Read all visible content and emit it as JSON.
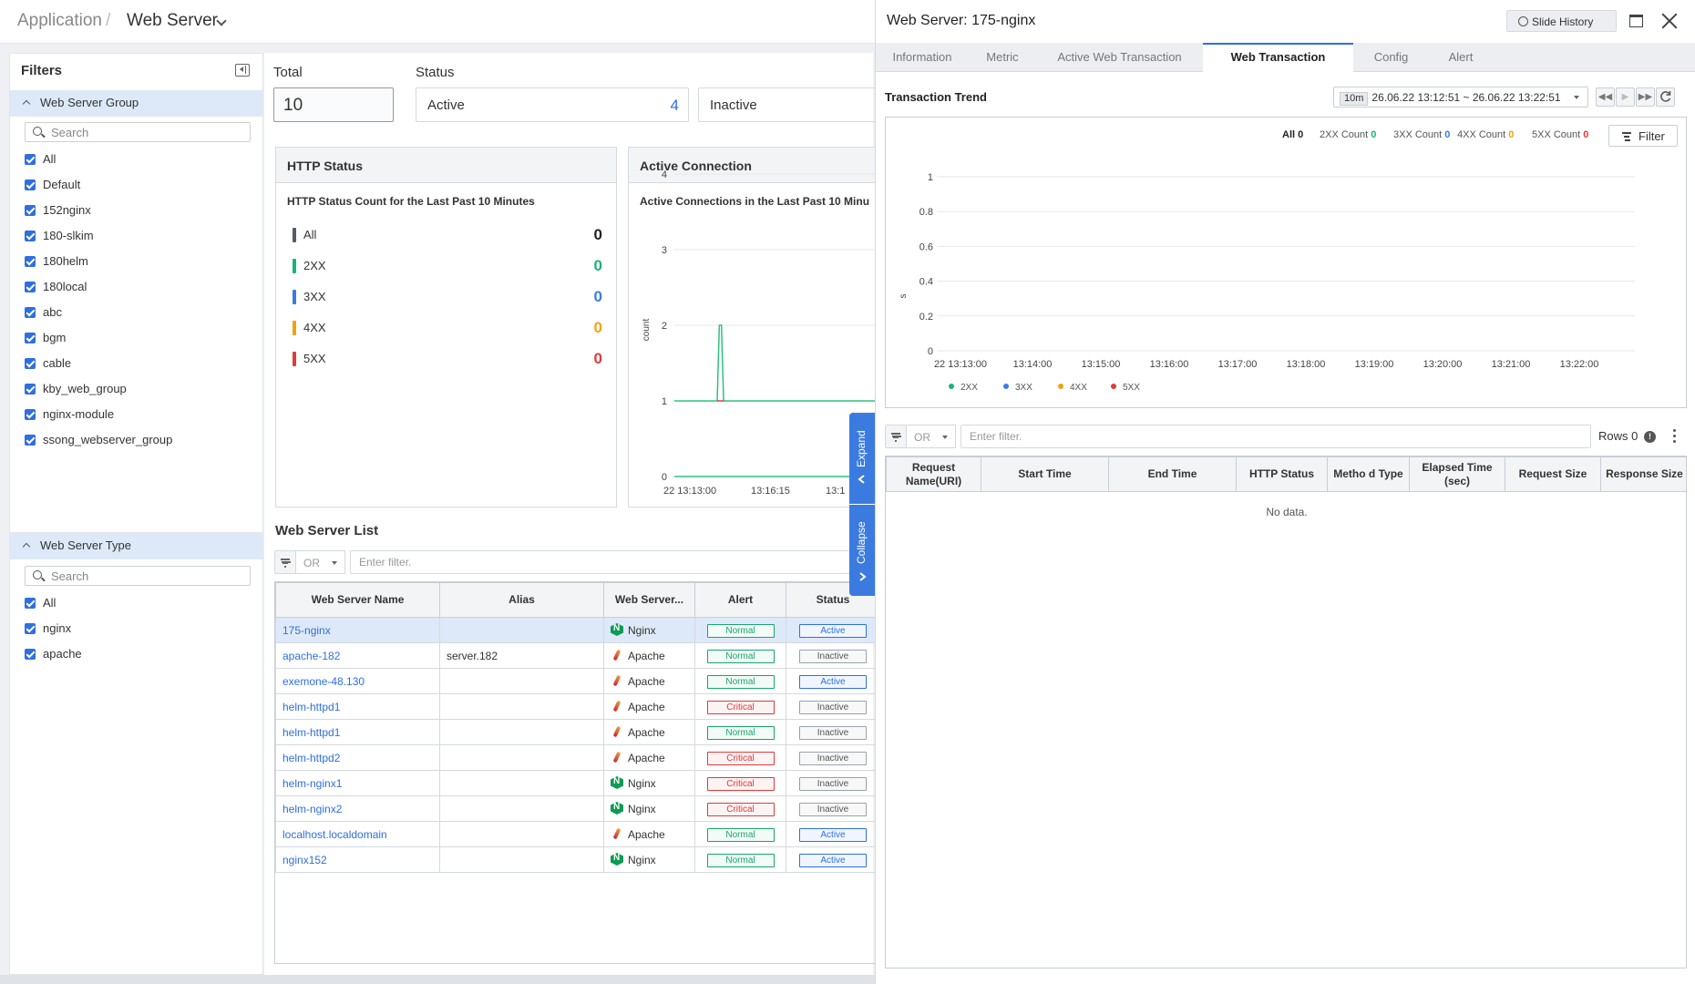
{
  "breadcrumb": {
    "parent": "Application",
    "sep": "/",
    "current": "Web Server"
  },
  "filters": {
    "title": "Filters",
    "group": {
      "title": "Web Server Group",
      "placeholder": "Search",
      "items": [
        "All",
        "Default",
        "152nginx",
        "180-slkim",
        "180helm",
        "180local",
        "abc",
        "bgm",
        "cable",
        "kby_web_group",
        "nginx-module",
        "ssong_webserver_group"
      ]
    },
    "type": {
      "title": "Web Server Type",
      "placeholder": "Search",
      "items": [
        "All",
        "nginx",
        "apache"
      ]
    }
  },
  "summary": {
    "total_label": "Total",
    "total": "10",
    "status_label": "Status",
    "active_label": "Active",
    "active": "4",
    "inactive_label": "Inactive"
  },
  "http_status": {
    "title": "HTTP Status",
    "subtitle": "HTTP Status Count for the Last Past 10 Minutes",
    "rows": [
      {
        "name": "All",
        "value": "0",
        "color": "#555b66"
      },
      {
        "name": "2XX",
        "value": "0",
        "color": "#19b27a"
      },
      {
        "name": "3XX",
        "value": "0",
        "color": "#3b7be0"
      },
      {
        "name": "4XX",
        "value": "0",
        "color": "#f0a30a"
      },
      {
        "name": "5XX",
        "value": "0",
        "color": "#e03a3a"
      }
    ]
  },
  "active_conn": {
    "title": "Active Connection",
    "subtitle": "Active Connections in the Last Past 10 Minu",
    "chart_data": {
      "type": "line",
      "ylabel": "count",
      "ylim": [
        0,
        4
      ],
      "yticks": [
        "0",
        "1",
        "2",
        "3",
        "4"
      ],
      "xticks": [
        "22 13:13:00",
        "13:16:15",
        "13:1"
      ],
      "series": [
        {
          "name": "",
          "color": "#2ec27e",
          "x": [
            0,
            0.2,
            0.21,
            0.22,
            0.23,
            1
          ],
          "values": [
            1,
            1,
            2,
            2,
            1,
            1
          ]
        },
        {
          "name": "",
          "color": "#2ec27e",
          "x": [
            0,
            1
          ],
          "values": [
            0,
            0
          ]
        }
      ]
    }
  },
  "list": {
    "title": "Web Server List",
    "or": "OR",
    "placeholder": "Enter filter.",
    "columns": [
      "Web Server Name",
      "Alias",
      "Web Server...",
      "Alert",
      "Status"
    ],
    "rows": [
      {
        "name": "175-nginx",
        "alias": "",
        "type": "Nginx",
        "alert": "Normal",
        "status": "Active"
      },
      {
        "name": "apache-182",
        "alias": "server.182",
        "type": "Apache",
        "alert": "Normal",
        "status": "Inactive"
      },
      {
        "name": "exemone-48.130",
        "alias": "",
        "type": "Apache",
        "alert": "Normal",
        "status": "Active"
      },
      {
        "name": "helm-httpd1",
        "alias": "",
        "type": "Apache",
        "alert": "Critical",
        "status": "Inactive"
      },
      {
        "name": "helm-httpd1",
        "alias": "",
        "type": "Apache",
        "alert": "Normal",
        "status": "Inactive"
      },
      {
        "name": "helm-httpd2",
        "alias": "",
        "type": "Apache",
        "alert": "Critical",
        "status": "Inactive"
      },
      {
        "name": "helm-nginx1",
        "alias": "",
        "type": "Nginx",
        "alert": "Critical",
        "status": "Inactive"
      },
      {
        "name": "helm-nginx2",
        "alias": "",
        "type": "Nginx",
        "alert": "Critical",
        "status": "Inactive"
      },
      {
        "name": "localhost.localdomain",
        "alias": "",
        "type": "Apache",
        "alert": "Normal",
        "status": "Active"
      },
      {
        "name": "nginx152",
        "alias": "",
        "type": "Nginx",
        "alert": "Normal",
        "status": "Active"
      }
    ]
  },
  "side_tabs": {
    "expand": "Expand",
    "collapse": "Collapse"
  },
  "panel": {
    "title": "Web Server: 175-nginx",
    "history": "Slide History",
    "tabs": [
      "Information",
      "Metric",
      "Active Web Transaction",
      "Web Transaction",
      "Config",
      "Alert"
    ],
    "active_tab": "Web Transaction",
    "trend_title": "Transaction Trend",
    "range_badge": "10m",
    "range": "26.06.22 13:12:51 ~ 26.06.22 13:22:51",
    "legend_counts": [
      {
        "label": "All",
        "value": "0",
        "color": "#222"
      },
      {
        "label": "2XX Count",
        "value": "0",
        "color": "#19b27a"
      },
      {
        "label": "3XX Count",
        "value": "0",
        "color": "#3b7be0"
      },
      {
        "label": "4XX Count",
        "value": "0",
        "color": "#f0a30a"
      },
      {
        "label": "5XX Count",
        "value": "0",
        "color": "#e03a3a"
      }
    ],
    "filter_label": "Filter",
    "chart_data": {
      "type": "line",
      "ylabel": "s",
      "ylim": [
        0,
        1
      ],
      "yticks": [
        "0",
        "0.2",
        "0.4",
        "0.6",
        "0.8",
        "1"
      ],
      "xticks": [
        "22 13:13:00",
        "13:14:00",
        "13:15:00",
        "13:16:00",
        "13:17:00",
        "13:18:00",
        "13:19:00",
        "13:20:00",
        "13:21:00",
        "13:22:00"
      ],
      "series": [
        {
          "name": "2XX",
          "color": "#19b27a",
          "values": []
        },
        {
          "name": "3XX",
          "color": "#3b7be0",
          "values": []
        },
        {
          "name": "4XX",
          "color": "#f0a30a",
          "values": []
        },
        {
          "name": "5XX",
          "color": "#e03a3a",
          "values": []
        }
      ]
    },
    "or": "OR",
    "placeholder": "Enter filter.",
    "rows_label": "Rows 0",
    "columns": [
      "Request Name(URI)",
      "Start Time",
      "End Time",
      "HTTP Status",
      "Metho d Type",
      "Elapsed Time (sec)",
      "Request Size",
      "Response Size"
    ],
    "nodata": "No data."
  }
}
